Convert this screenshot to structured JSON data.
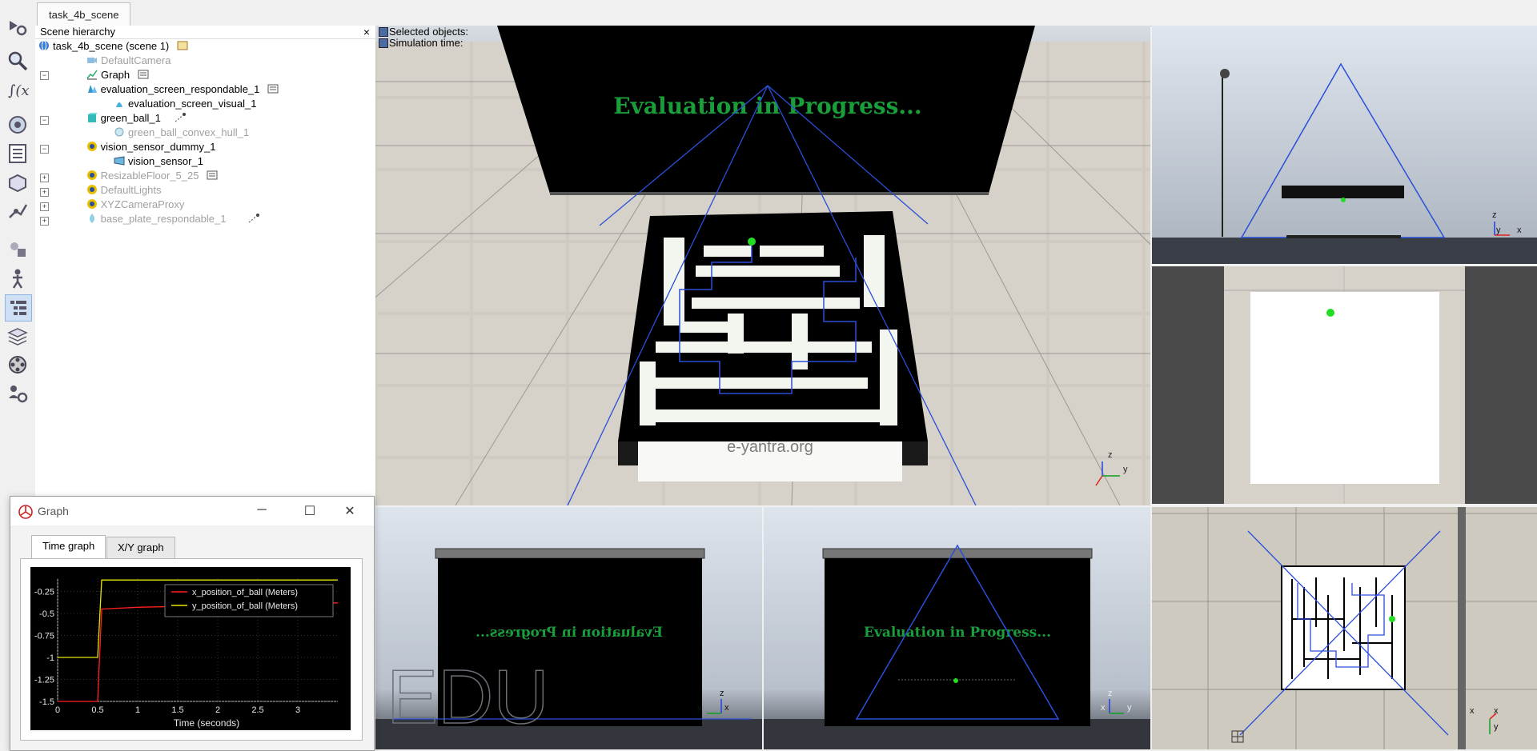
{
  "tab": {
    "label": "task_4b_scene"
  },
  "toolbar": {
    "items": [
      "simulation-settings",
      "zoom",
      "script-functions",
      "object-properties",
      "page-layout",
      "collection",
      "model-browser",
      "shape-edit",
      "human-model",
      "scene-hierarchy",
      "layers",
      "video-recorder",
      "user-settings"
    ]
  },
  "hierarchy": {
    "title": "Scene hierarchy",
    "items": [
      {
        "label": "task_4b_scene (scene 1)",
        "dim": false
      },
      {
        "label": "DefaultCamera",
        "dim": true
      },
      {
        "label": "Graph",
        "dim": false
      },
      {
        "label": "evaluation_screen_respondable_1",
        "dim": false
      },
      {
        "label": "evaluation_screen_visual_1",
        "dim": false
      },
      {
        "label": "green_ball_1",
        "dim": false
      },
      {
        "label": "green_ball_convex_hull_1",
        "dim": true
      },
      {
        "label": "vision_sensor_dummy_1",
        "dim": false
      },
      {
        "label": "vision_sensor_1",
        "dim": false
      },
      {
        "label": "ResizableFloor_5_25",
        "dim": true
      },
      {
        "label": "DefaultLights",
        "dim": true
      },
      {
        "label": "XYZCameraProxy",
        "dim": true
      },
      {
        "label": "base_plate_respondable_1",
        "dim": true
      }
    ]
  },
  "viewport": {
    "selected_label": "Selected objects:",
    "simulation_label": "Simulation time:",
    "screen_text": "Evaluation in Progress...",
    "screen_text_mirrored": "Evaluation in Progress...",
    "brand_text": "e-yantra.org",
    "edu_watermark": "EDU",
    "axis_z": "z",
    "axis_y": "y",
    "axis_x": "x"
  },
  "graph_window": {
    "title": "Graph",
    "tabs": [
      "Time graph",
      "X/Y graph"
    ],
    "active_tab": "Time graph"
  },
  "chart_data": {
    "type": "line",
    "title": "",
    "xlabel": "Time (seconds)",
    "ylabel": "",
    "xlim": [
      0,
      3.5
    ],
    "ylim": [
      -1.5,
      -0.1
    ],
    "x_ticks": [
      "0",
      "0.5",
      "1",
      "1.5",
      "2",
      "2.5",
      "3"
    ],
    "y_ticks": [
      "-0.25",
      "-0.5",
      "-0.75",
      "-1",
      "-1.25",
      "-1.5"
    ],
    "legend_position": "top-right",
    "series": [
      {
        "name": "x_position_of_ball (Meters)",
        "color": "#ff2020",
        "x": [
          0,
          0.45,
          0.5,
          0.55,
          1.0,
          3.5
        ],
        "y": [
          -1.5,
          -1.5,
          -1.5,
          -0.45,
          -0.43,
          -0.38
        ]
      },
      {
        "name": "y_position_of_ball (Meters)",
        "color": "#e6e600",
        "x": [
          0,
          0.45,
          0.5,
          0.55,
          1.0,
          3.5
        ],
        "y": [
          -1.0,
          -1.0,
          -1.0,
          -0.12,
          -0.12,
          -0.12
        ]
      }
    ]
  },
  "colors": {
    "blue_lines": "#2a4fd8",
    "screen_green": "#1a9e3c",
    "ball_green": "#22dd22"
  }
}
